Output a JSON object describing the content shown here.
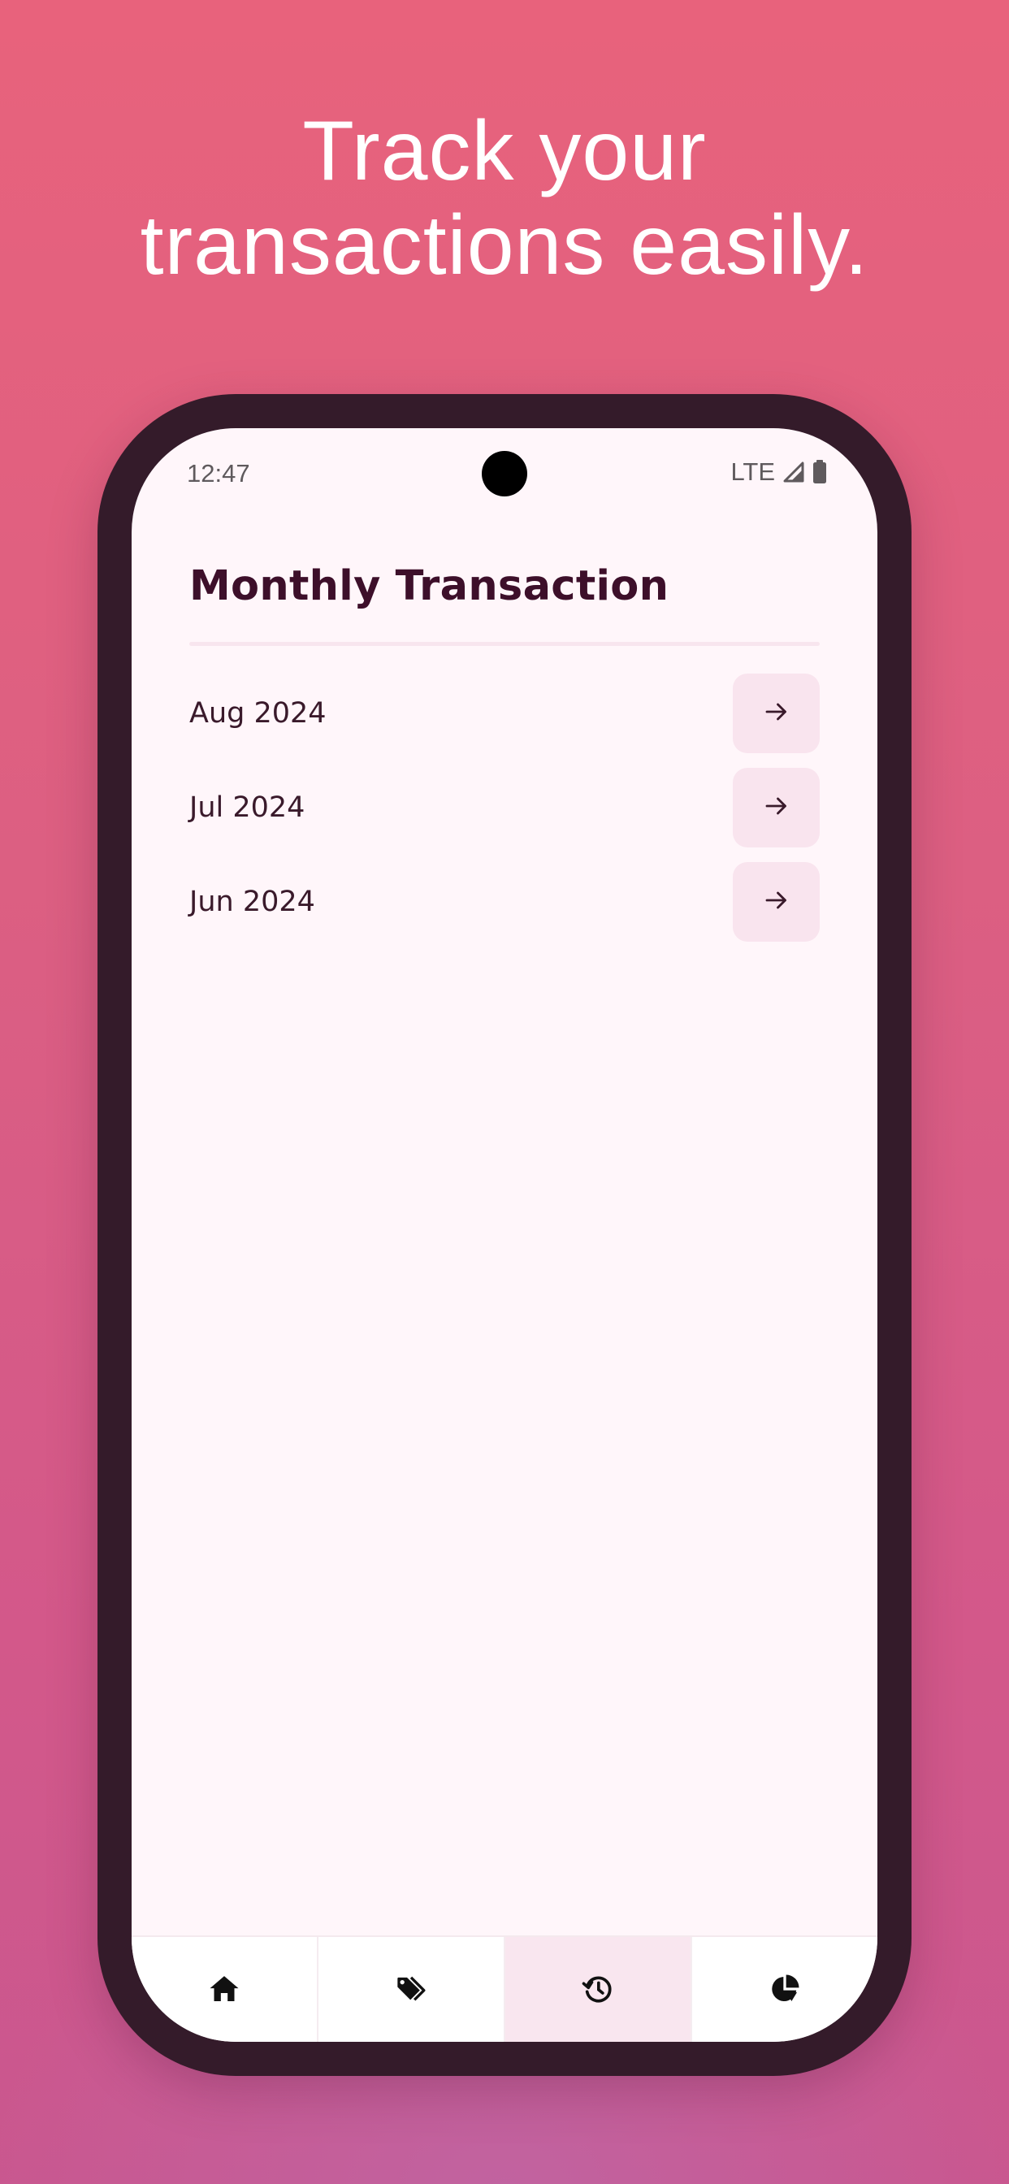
{
  "headline": {
    "line1": "Track your",
    "line2": "transactions easily."
  },
  "status_bar": {
    "time": "12:47",
    "network": "LTE",
    "icons": [
      "signal-icon",
      "battery-icon"
    ]
  },
  "page": {
    "title": "Monthly Transaction"
  },
  "months": [
    {
      "label": "Aug 2024",
      "action_icon": "arrow-right-icon"
    },
    {
      "label": "Jul 2024",
      "action_icon": "arrow-right-icon"
    },
    {
      "label": "Jun 2024",
      "action_icon": "arrow-right-icon"
    }
  ],
  "bottom_nav": {
    "items": [
      {
        "icon": "home-icon",
        "active": false
      },
      {
        "icon": "tags-icon",
        "active": false
      },
      {
        "icon": "history-icon",
        "active": true
      },
      {
        "icon": "pie-chart-icon",
        "active": false
      }
    ]
  },
  "colors": {
    "background_top": "#e8627c",
    "background_bottom": "#c9578f",
    "phone_frame": "#341b2a",
    "screen_bg": "#fff6fa",
    "title_text": "#3d0f2a",
    "button_bg": "#f9e4ee",
    "active_nav_bg": "#f9e6ef"
  }
}
